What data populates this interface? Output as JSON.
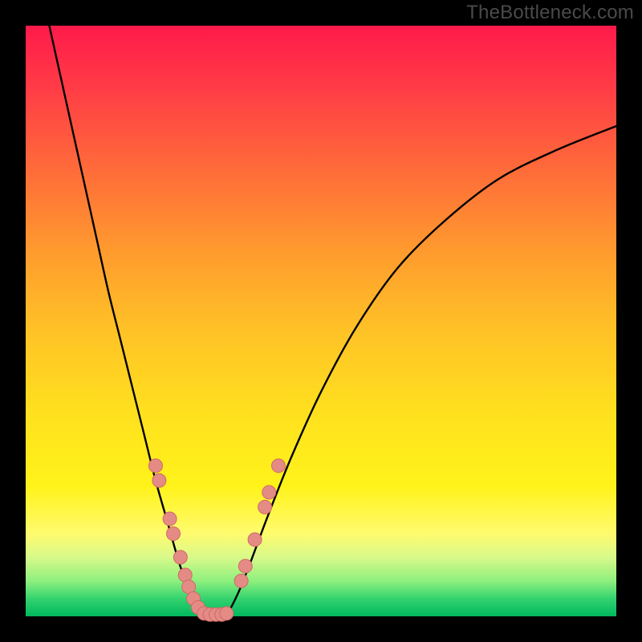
{
  "watermark": "TheBottleneck.com",
  "colors": {
    "frame": "#000000",
    "gradient_top": "#ff1a4b",
    "gradient_bottom": "#00b85e",
    "curve_stroke": "#000000",
    "marker_fill": "#e48b86",
    "marker_stroke": "#cf6a65"
  },
  "chart_data": {
    "type": "line",
    "title": "",
    "xlabel": "",
    "ylabel": "",
    "xlim": [
      0,
      100
    ],
    "ylim": [
      0,
      100
    ],
    "series": [
      {
        "name": "left-curve",
        "x": [
          4,
          6,
          8,
          10,
          12,
          14,
          16,
          18,
          20,
          22,
          24,
          26,
          27.5,
          29,
          30.5
        ],
        "y": [
          100,
          91,
          82,
          73,
          64,
          55,
          47,
          39,
          31,
          23,
          16,
          9,
          5,
          2,
          0
        ]
      },
      {
        "name": "right-curve",
        "x": [
          34,
          36,
          38,
          41,
          45,
          50,
          56,
          63,
          71,
          80,
          90,
          100
        ],
        "y": [
          0,
          4,
          9,
          17,
          27,
          38,
          49,
          59,
          67,
          74,
          79,
          83
        ]
      },
      {
        "name": "bottom-flat",
        "x": [
          30.5,
          32,
          34
        ],
        "y": [
          0,
          0,
          0
        ]
      }
    ],
    "markers": [
      {
        "x": 22.0,
        "y": 25.5
      },
      {
        "x": 22.6,
        "y": 23.0
      },
      {
        "x": 24.4,
        "y": 16.5
      },
      {
        "x": 25.0,
        "y": 14.0
      },
      {
        "x": 26.2,
        "y": 10.0
      },
      {
        "x": 27.0,
        "y": 7.0
      },
      {
        "x": 27.6,
        "y": 5.0
      },
      {
        "x": 28.4,
        "y": 3.0
      },
      {
        "x": 29.2,
        "y": 1.5
      },
      {
        "x": 30.2,
        "y": 0.5
      },
      {
        "x": 31.2,
        "y": 0.3
      },
      {
        "x": 32.2,
        "y": 0.3
      },
      {
        "x": 33.2,
        "y": 0.3
      },
      {
        "x": 34.0,
        "y": 0.5
      },
      {
        "x": 36.5,
        "y": 6.0
      },
      {
        "x": 37.2,
        "y": 8.5
      },
      {
        "x": 38.8,
        "y": 13.0
      },
      {
        "x": 40.5,
        "y": 18.5
      },
      {
        "x": 41.2,
        "y": 21.0
      },
      {
        "x": 42.8,
        "y": 25.5
      }
    ]
  }
}
